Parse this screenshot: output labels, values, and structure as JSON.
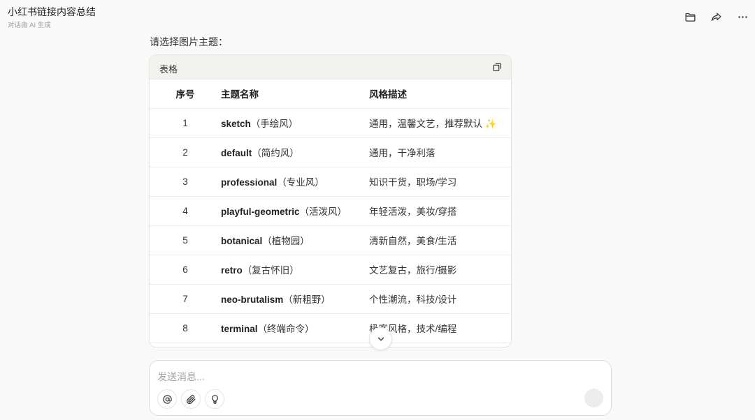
{
  "header": {
    "title": "小红书链接内容总结",
    "subtitle": "对话由 AI 生成"
  },
  "message": {
    "prompt": "请选择图片主题："
  },
  "table": {
    "label": "表格",
    "columns": [
      "序号",
      "主题名称",
      "风格描述"
    ],
    "rows": [
      {
        "num": "1",
        "name": "sketch",
        "alias": "（手绘风）",
        "desc": "通用，温馨文艺，推荐默认 ✨"
      },
      {
        "num": "2",
        "name": "default",
        "alias": "（简约风）",
        "desc": "通用，干净利落"
      },
      {
        "num": "3",
        "name": "professional",
        "alias": "（专业风）",
        "desc": "知识干货，职场/学习"
      },
      {
        "num": "4",
        "name": "playful-geometric",
        "alias": "（活泼风）",
        "desc": "年轻活泼，美妆/穿搭"
      },
      {
        "num": "5",
        "name": "botanical",
        "alias": "（植物园）",
        "desc": "清新自然，美食/生活"
      },
      {
        "num": "6",
        "name": "retro",
        "alias": "（复古怀旧）",
        "desc": "文艺复古，旅行/摄影"
      },
      {
        "num": "7",
        "name": "neo-brutalism",
        "alias": "（新粗野）",
        "desc": "个性潮流，科技/设计"
      },
      {
        "num": "8",
        "name": "terminal",
        "alias": "（终端命令）",
        "desc": "极客风格，技术/编程"
      }
    ]
  },
  "composer": {
    "placeholder": "发送消息..."
  },
  "icons": {
    "folder": "folder-icon",
    "share": "share-icon",
    "more": "more-icon",
    "copy": "copy-icon",
    "chevron": "chevron-down-icon",
    "mention": "at-icon",
    "attach": "paperclip-icon",
    "idea": "lightbulb-icon"
  }
}
